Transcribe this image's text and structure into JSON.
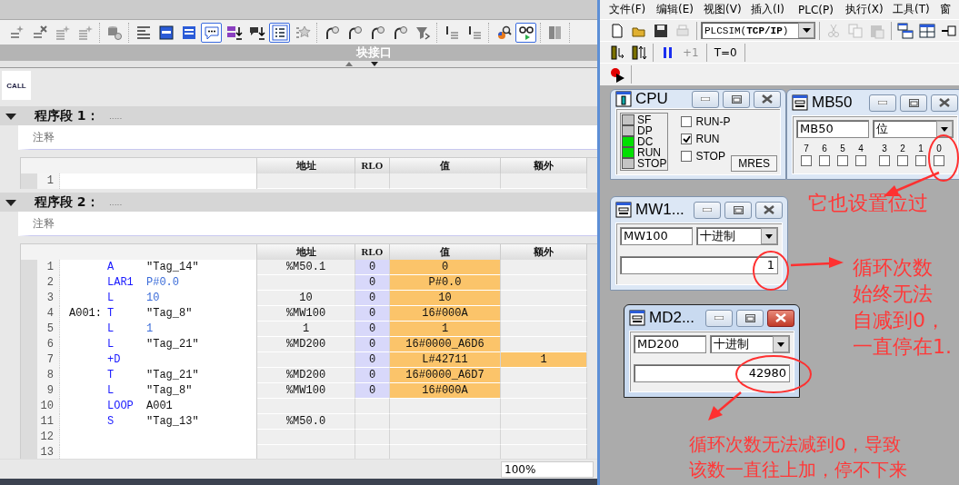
{
  "editor": {
    "toolbar": {
      "groups": [
        {
          "buttons": [
            {
              "selected": false
            },
            {
              "selected": false
            },
            {
              "selected": false
            },
            {
              "selected": false
            }
          ]
        },
        {
          "buttons": [
            {
              "selected": false
            }
          ]
        },
        {
          "buttons": [
            {
              "selected": false
            },
            {
              "selected": false
            },
            {
              "selected": false
            },
            {
              "selected": true
            },
            {
              "selected": false
            },
            {
              "selected": false
            },
            {
              "selected": true
            },
            {
              "selected": false
            }
          ]
        },
        {
          "buttons": [
            {
              "selected": false
            },
            {
              "selected": false
            },
            {
              "selected": false
            },
            {
              "selected": false
            },
            {
              "selected": false
            }
          ]
        },
        {
          "buttons": [
            {
              "selected": false
            },
            {
              "selected": false
            }
          ]
        },
        {
          "buttons": [
            {
              "selected": false
            },
            {
              "selected": true
            }
          ]
        },
        {
          "buttons": [
            {
              "selected": false
            }
          ]
        }
      ]
    },
    "interface_title": "块接口",
    "call_button": "CALL",
    "networks": [
      {
        "title": "程序段 1：",
        "dots": ".....",
        "expanded": true,
        "comment_placeholder": "注释",
        "columns": [
          "地址",
          "RLO",
          "值",
          "额外"
        ],
        "rows": [
          {
            "number": "1"
          }
        ]
      },
      {
        "title": "程序段 2：",
        "dots": ".....",
        "expanded": true,
        "comment_placeholder": "注释",
        "columns": [
          "地址",
          "RLO",
          "值",
          "额外"
        ],
        "rows": [
          {
            "number": "1",
            "op": "A",
            "operand": {
              "text": "\"Tag_14\"",
              "kind": "tag"
            },
            "address": "%M50.1",
            "rlo": "0",
            "value": "0"
          },
          {
            "number": "2",
            "op": "LAR1",
            "operand": {
              "text": "P#0.0",
              "kind": "literal"
            },
            "rlo": "0",
            "value": "P#0.0"
          },
          {
            "number": "3",
            "op": "L",
            "operand": {
              "text": "10",
              "kind": "literal"
            },
            "address": "10",
            "rlo": "0",
            "value": "10"
          },
          {
            "number": "4",
            "label": "A001:",
            "op": "T",
            "operand": {
              "text": "\"Tag_8\"",
              "kind": "tag"
            },
            "address": "%MW100",
            "rlo": "0",
            "value": "16#000A"
          },
          {
            "number": "5",
            "op": "L",
            "operand": {
              "text": "1",
              "kind": "literal"
            },
            "address": "1",
            "rlo": "0",
            "value": "1"
          },
          {
            "number": "6",
            "op": "L",
            "operand": {
              "text": "\"Tag_21\"",
              "kind": "tag"
            },
            "address": "%MD200",
            "rlo": "0",
            "value": "16#0000_A6D6"
          },
          {
            "number": "7",
            "op": "+D",
            "rlo": "0",
            "value": "L#42711",
            "extra": "1"
          },
          {
            "number": "8",
            "op": "T",
            "operand": {
              "text": "\"Tag_21\"",
              "kind": "tag"
            },
            "address": "%MD200",
            "rlo": "0",
            "value": "16#0000_A6D7"
          },
          {
            "number": "9",
            "op": "L",
            "operand": {
              "text": "\"Tag_8\"",
              "kind": "tag"
            },
            "address": "%MW100",
            "rlo": "0",
            "value": "16#000A"
          },
          {
            "number": "10",
            "op": "LOOP",
            "operand": {
              "text": "A001",
              "kind": "tag"
            }
          },
          {
            "number": "11",
            "op": "S",
            "operand": {
              "text": "\"Tag_13\"",
              "kind": "tag"
            },
            "address": "%M50.0"
          },
          {
            "number": "12"
          },
          {
            "number": "13"
          }
        ]
      }
    ],
    "zoom": "100%"
  },
  "simulator": {
    "menu": [
      "文件(F)",
      "编辑(E)",
      "视图(V)",
      "插入(I)",
      "PLC(P)",
      "执行(X)",
      "工具(T)",
      "窗"
    ],
    "toolbar_rows": [
      {
        "groups": [
          [
            {
              "kind": "icon",
              "disabled": false
            },
            {
              "kind": "icon",
              "disabled": false
            },
            {
              "kind": "icon",
              "disabled": false
            },
            {
              "kind": "icon",
              "disabled": true
            }
          ],
          [
            {
              "kind": "dropdown",
              "value": "PLCSIM(**TCP/IP**)"
            }
          ],
          [
            {
              "kind": "icon",
              "disabled": true
            },
            {
              "kind": "icon",
              "disabled": true
            },
            {
              "kind": "icon",
              "disabled": true
            }
          ],
          [
            {
              "kind": "icon",
              "disabled": false
            },
            {
              "kind": "icon",
              "disabled": false
            },
            {
              "kind": "icon",
              "disabled": false
            }
          ]
        ]
      },
      {
        "groups": [
          [
            {
              "kind": "icon",
              "disabled": false
            },
            {
              "kind": "icon",
              "disabled": false
            }
          ],
          [
            {
              "kind": "icon",
              "disabled": false
            },
            {
              "kind": "text",
              "label": "+1",
              "disabled": true
            }
          ],
          [
            {
              "kind": "text",
              "label": "T=0",
              "disabled": false
            }
          ]
        ]
      },
      {
        "groups": [
          [
            {
              "kind": "icon",
              "disabled": false
            }
          ]
        ]
      }
    ],
    "windows": [
      {
        "kind": "cpu",
        "title": "CPU",
        "active": false,
        "leds": [
          {
            "label": "SF",
            "on": false
          },
          {
            "label": "DP",
            "on": false
          },
          {
            "label": "DC",
            "on": true
          },
          {
            "label": "RUN",
            "on": true
          },
          {
            "label": "STOP",
            "on": false
          }
        ],
        "modes": [
          {
            "label": "RUN-P",
            "checked": false
          },
          {
            "label": "RUN",
            "checked": true
          },
          {
            "label": "STOP",
            "checked": false
          }
        ],
        "reset_button": "MRES"
      },
      {
        "kind": "bits",
        "title": "MB50",
        "active": false,
        "address": "MB50",
        "format": "位",
        "bits": [
          {
            "label": "7",
            "checked": false
          },
          {
            "label": "6",
            "checked": false
          },
          {
            "label": "5",
            "checked": false
          },
          {
            "label": "4",
            "checked": false
          },
          {
            "label": "3",
            "checked": false
          },
          {
            "label": "2",
            "checked": false
          },
          {
            "label": "1",
            "checked": false
          },
          {
            "label": "0",
            "checked": false
          }
        ]
      },
      {
        "kind": "value",
        "title": "MW1...",
        "active": false,
        "address": "MW100",
        "format": "十进制",
        "value": "1"
      },
      {
        "kind": "value",
        "title": "MD2...",
        "active": true,
        "address": "MD200",
        "format": "十进制",
        "value": "42980"
      }
    ],
    "annotations": [
      {
        "lines": [
          "它也设置位过"
        ]
      },
      {
        "lines": [
          "循环次数",
          "始终无法",
          "自减到0，",
          "一直停在1."
        ]
      },
      {
        "lines": [
          "循环次数无法减到0，导致",
          "该数一直往上加，停不下来"
        ]
      }
    ]
  }
}
